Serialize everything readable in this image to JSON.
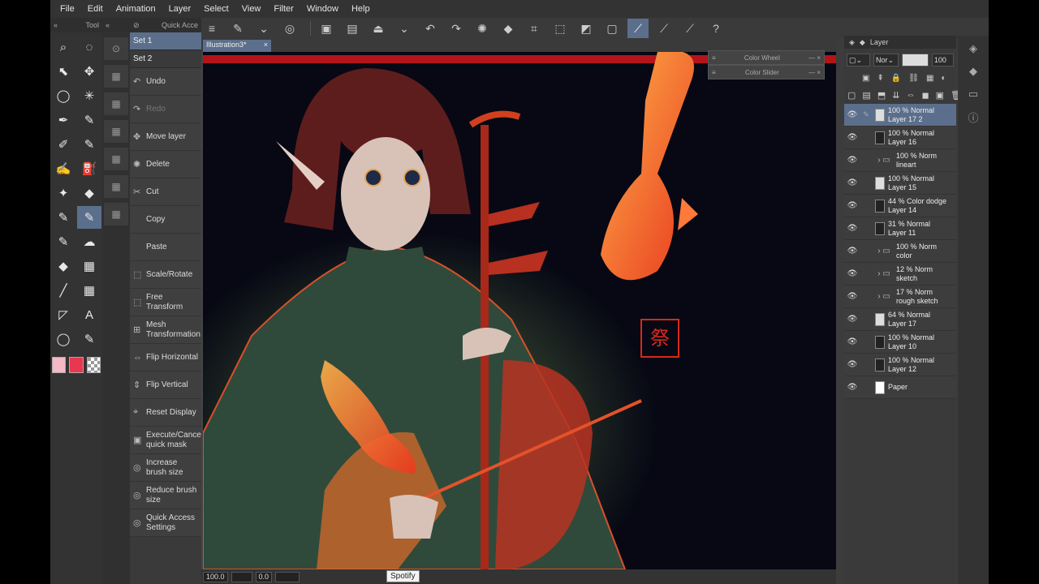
{
  "menu": [
    "File",
    "Edit",
    "Animation",
    "Layer",
    "Select",
    "View",
    "Filter",
    "Window",
    "Help"
  ],
  "tool_palette": {
    "title": "Tool"
  },
  "quick_access": {
    "title": "Quick Acce",
    "sets": [
      "Set 1",
      "Set 2"
    ],
    "items": [
      {
        "label": "Undo",
        "icon": "undo-icon",
        "dim": false
      },
      {
        "label": "Redo",
        "icon": "redo-icon",
        "dim": true
      },
      {
        "label": "Move layer",
        "icon": "move-icon",
        "dim": false
      },
      {
        "label": "Delete",
        "icon": "delete-icon",
        "dim": false
      },
      {
        "label": "Cut",
        "icon": "scissors-icon",
        "dim": false
      },
      {
        "label": "Copy",
        "icon": "copy-icon",
        "dim": false
      },
      {
        "label": "Paste",
        "icon": "paste-icon",
        "dim": false
      },
      {
        "label": "Scale/Rotate",
        "icon": "scale-icon",
        "dim": false
      },
      {
        "label": "Free Transform",
        "icon": "transform-icon",
        "dim": false
      },
      {
        "label": "Mesh Transformation",
        "icon": "mesh-icon",
        "dim": false
      },
      {
        "label": "Flip Horizontal",
        "icon": "flip-h-icon",
        "dim": false
      },
      {
        "label": "Flip Vertical",
        "icon": "flip-v-icon",
        "dim": false
      },
      {
        "label": "Reset Display",
        "icon": "reset-icon",
        "dim": false
      },
      {
        "label": "Execute/Cancel quick mask",
        "icon": "mask-icon",
        "dim": false
      },
      {
        "label": "Increase brush size",
        "icon": "brush-plus-icon",
        "dim": false
      },
      {
        "label": "Reduce brush size",
        "icon": "brush-minus-icon",
        "dim": false
      },
      {
        "label": "Quick Access Settings",
        "icon": "settings-icon",
        "dim": false
      }
    ]
  },
  "document": {
    "tab": "Illustration3*"
  },
  "floating": [
    {
      "title": "Color Wheel"
    },
    {
      "title": "Color Slider"
    }
  ],
  "layer_panel": {
    "tab": "Layer",
    "blend": "Nor",
    "opacity": "100",
    "layers": [
      {
        "pct": "100 %",
        "mode": "Normal",
        "name": "Layer 17 2",
        "type": "raster",
        "selected": true
      },
      {
        "pct": "100 %",
        "mode": "Normal",
        "name": "Layer 16",
        "type": "raster",
        "selected": false
      },
      {
        "pct": "100 %",
        "mode": "Norm",
        "name": "lineart",
        "type": "folder",
        "selected": false
      },
      {
        "pct": "100 %",
        "mode": "Normal",
        "name": "Layer 15",
        "type": "raster",
        "selected": false
      },
      {
        "pct": "44 %",
        "mode": "Color dodge",
        "name": "Layer 14",
        "type": "raster",
        "selected": false
      },
      {
        "pct": "31 %",
        "mode": "Normal",
        "name": "Layer 11",
        "type": "raster",
        "selected": false
      },
      {
        "pct": "100 %",
        "mode": "Norm",
        "name": "color",
        "type": "folder",
        "selected": false
      },
      {
        "pct": "12 %",
        "mode": "Norm",
        "name": "sketch",
        "type": "folder",
        "selected": false
      },
      {
        "pct": "17 %",
        "mode": "Norm",
        "name": "rough sketch",
        "type": "folder",
        "selected": false
      },
      {
        "pct": "64 %",
        "mode": "Normal",
        "name": "Layer 17",
        "type": "raster",
        "selected": false
      },
      {
        "pct": "100 %",
        "mode": "Normal",
        "name": "Layer 10",
        "type": "raster",
        "selected": false
      },
      {
        "pct": "100 %",
        "mode": "Normal",
        "name": "Layer 12",
        "type": "raster",
        "selected": false
      },
      {
        "pct": "",
        "mode": "",
        "name": "Paper",
        "type": "paper",
        "selected": false
      }
    ]
  },
  "status": {
    "zoom": "100.0",
    "angle": "0.0"
  },
  "tooltip": "Spotify",
  "colors": {
    "main": "#f4b9c4",
    "sub": "#e8384f",
    "accent": "#5b6f8c"
  }
}
